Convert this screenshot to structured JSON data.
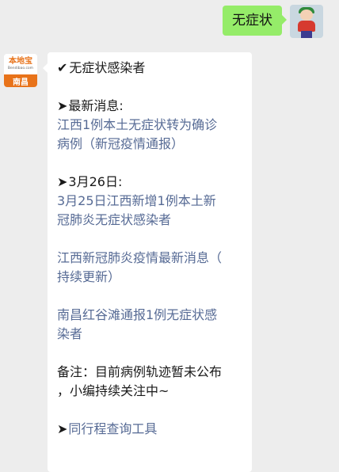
{
  "outgoing": {
    "text": "无症状"
  },
  "account": {
    "brand": "本地宝",
    "domain": "Bendibao.com",
    "city": "南昌"
  },
  "reply": {
    "heading_icon": "✔",
    "heading": "无症状感染者",
    "arrow": "➤",
    "section1_label": "最新消息:",
    "link1_line1": "江西1例本土无症状转为确诊",
    "link1_line2": "病例（新冠疫情通报）",
    "section2_label": "3月26日:",
    "link2_line1": "3月25日江西新增1例本土新",
    "link2_line2": "冠肺炎无症状感染者",
    "link3_line1": "江西新冠肺炎疫情最新消息（",
    "link3_line2": "持续更新）",
    "link4_line1": "南昌红谷滩通报1例无症状感",
    "link4_line2": "染者",
    "note_line1": "备注：目前病例轨迹暂未公布",
    "note_line2": "，小编持续关注中~",
    "tool_link": "同行程查询工具"
  }
}
